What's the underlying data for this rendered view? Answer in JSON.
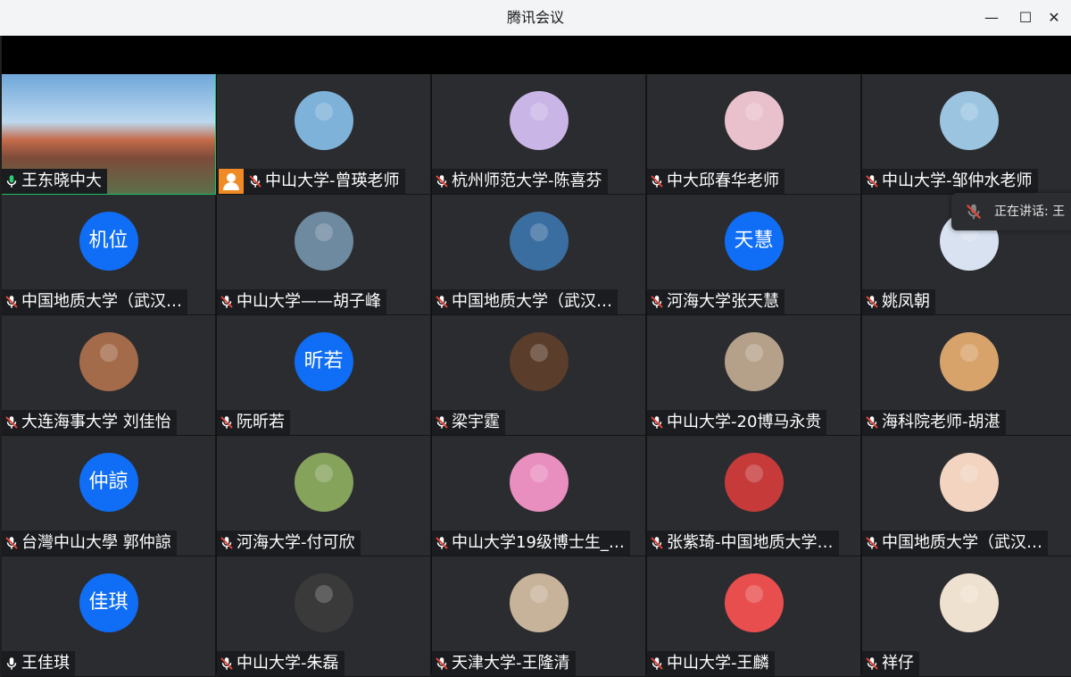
{
  "window": {
    "title": "腾讯会议"
  },
  "speaking_indicator": {
    "label": "正在讲话: 王"
  },
  "participants": [
    {
      "name": "王东晓中大",
      "avatar_text": "",
      "video": true,
      "mic": "on"
    },
    {
      "name": "中山大学-曾瑛老师",
      "avatar_text": "",
      "mic": "muted",
      "host": true
    },
    {
      "name": "杭州师范大学-陈喜芬",
      "avatar_text": "",
      "mic": "muted"
    },
    {
      "name": "中大邱春华老师",
      "avatar_text": "",
      "mic": "muted"
    },
    {
      "name": "中山大学-邹仲水老师",
      "avatar_text": "",
      "mic": "muted"
    },
    {
      "name": "中国地质大学（武汉…",
      "avatar_text": "机位",
      "mic": "muted"
    },
    {
      "name": "中山大学——胡子峰",
      "avatar_text": "",
      "mic": "muted"
    },
    {
      "name": "中国地质大学（武汉…",
      "avatar_text": "",
      "mic": "muted"
    },
    {
      "name": "河海大学张天慧",
      "avatar_text": "天慧",
      "mic": "muted"
    },
    {
      "name": "姚凤朝",
      "avatar_text": "",
      "mic": "muted"
    },
    {
      "name": "大连海事大学 刘佳怡",
      "avatar_text": "",
      "mic": "muted"
    },
    {
      "name": "阮昕若",
      "avatar_text": "昕若",
      "mic": "muted"
    },
    {
      "name": "梁宇霆",
      "avatar_text": "",
      "mic": "muted"
    },
    {
      "name": "中山大学-20博马永贵",
      "avatar_text": "",
      "mic": "muted"
    },
    {
      "name": "海科院老师-胡湛",
      "avatar_text": "",
      "mic": "muted"
    },
    {
      "name": "台灣中山大學 郭仲諒",
      "avatar_text": "仲諒",
      "mic": "muted"
    },
    {
      "name": "河海大学-付可欣",
      "avatar_text": "",
      "mic": "muted"
    },
    {
      "name": "中山大学19级博士生_…",
      "avatar_text": "",
      "mic": "muted"
    },
    {
      "name": "张紫琦-中国地质大学…",
      "avatar_text": "",
      "mic": "muted"
    },
    {
      "name": "中国地质大学（武汉…",
      "avatar_text": "",
      "mic": "muted"
    },
    {
      "name": "王佳琪",
      "avatar_text": "佳琪",
      "mic": "off"
    },
    {
      "name": "中山大学-朱磊",
      "avatar_text": "",
      "mic": "muted"
    },
    {
      "name": "天津大学-王隆清",
      "avatar_text": "",
      "mic": "muted"
    },
    {
      "name": "中山大学-王麟",
      "avatar_text": "",
      "mic": "muted"
    },
    {
      "name": "祥仔",
      "avatar_text": "",
      "mic": "muted"
    }
  ],
  "avatar_colors": [
    "#7fb2d8",
    "#c9b6e6",
    "#e9c1cc",
    "#9bc4e0",
    "#6e8aa0",
    "#3b6ea0",
    "#d9e2f1",
    "#a46b4a",
    "#5a3d2a",
    "#b5a18a",
    "#d8a36a",
    "#86a35c",
    "#e98fbf",
    "#c63a3a",
    "#f2d4c0",
    "#3a3a3a",
    "#c7b39a",
    "#e84e4e",
    "#efe1d0"
  ],
  "colors": {
    "accent": "#0f6ef5",
    "active_border": "#19c065",
    "host_badge": "#f08a24"
  }
}
